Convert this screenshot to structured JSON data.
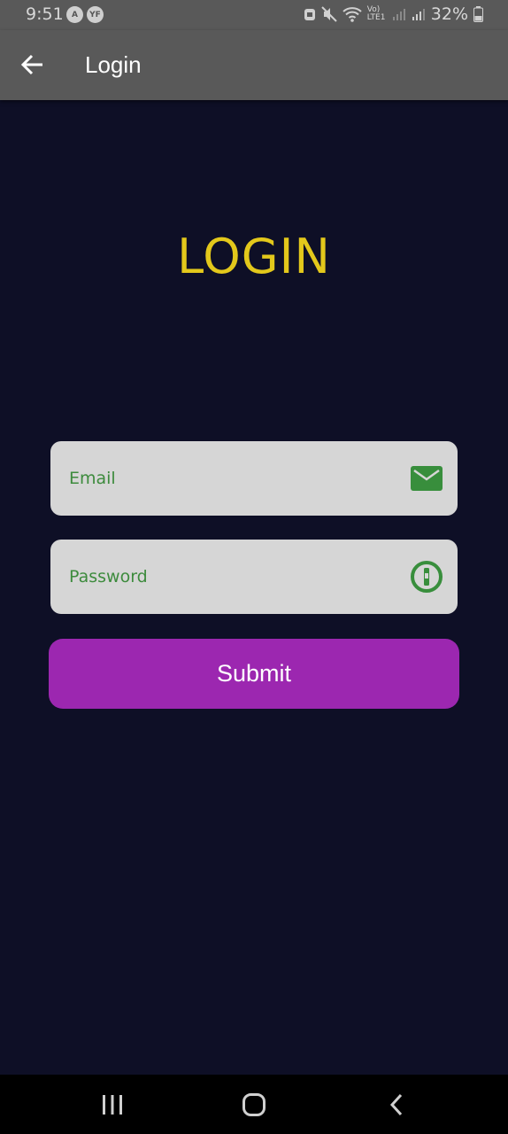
{
  "status_bar": {
    "time": "9:51",
    "notification_icons": [
      "A",
      "YF"
    ],
    "network_label": "Vo) LTE1",
    "battery_percent": "32%"
  },
  "app_bar": {
    "title": "Login",
    "back_icon": "arrow-left-icon"
  },
  "main": {
    "heading": "LOGIN",
    "email": {
      "placeholder": "Email",
      "value": "",
      "icon": "envelope-icon"
    },
    "password": {
      "placeholder": "Password",
      "value": "",
      "icon": "key-hole-icon"
    },
    "submit_label": "Submit"
  },
  "colors": {
    "background": "#0e0f26",
    "app_bar": "#595959",
    "heading": "#e3c81b",
    "field": "#d6d6d6",
    "field_text": "#3d8b3d",
    "button": "#9c27b0"
  },
  "nav_bar": {
    "recent_icon": "recent-apps-icon",
    "home_icon": "home-icon",
    "back_icon": "nav-back-icon"
  }
}
